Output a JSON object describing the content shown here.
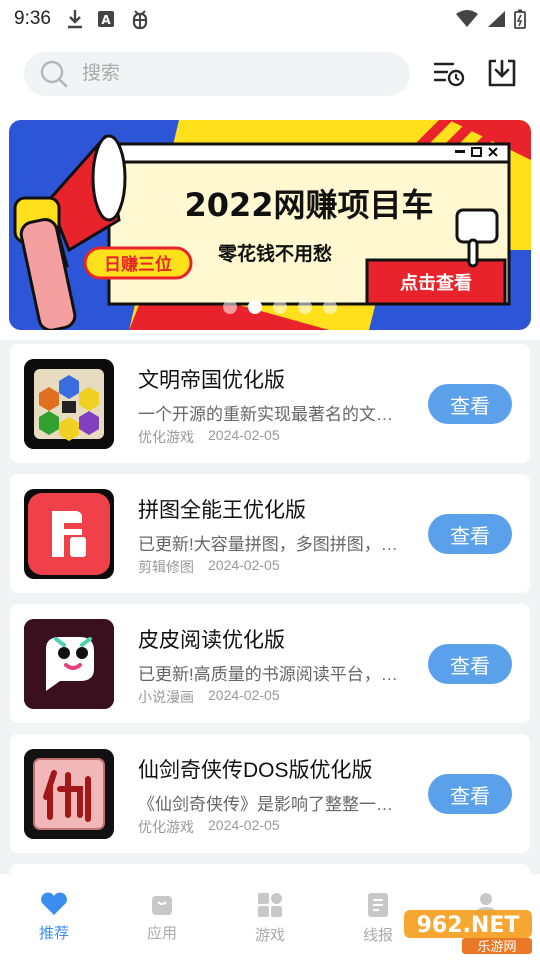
{
  "status_bar": {
    "time": "9:36"
  },
  "search": {
    "placeholder": "搜索"
  },
  "banner": {
    "headline": "2022网赚项目车",
    "tagline": "零花钱不用愁",
    "badge": "日赚三位",
    "cta": "点击查看",
    "slide_count": 5,
    "active_slide": 2
  },
  "apps": [
    {
      "title": "文明帝国优化版",
      "description": "一个开源的重新实现最著名的文明类游戏",
      "category": "优化游戏",
      "date": "2024-02-05",
      "button": "查看"
    },
    {
      "title": "拼图全能王优化版",
      "description": "已更新!大容量拼图，多图拼图，长图拼接",
      "category": "剪辑修图",
      "date": "2024-02-05",
      "button": "查看"
    },
    {
      "title": "皮皮阅读优化版",
      "description": "已更新!高质量的书源阅读平台，海量小说",
      "category": "小说漫画",
      "date": "2024-02-05",
      "button": "查看"
    },
    {
      "title": "仙剑奇侠传DOS版优化版",
      "description": "《仙剑奇侠传》是影响了整整一代人的经典",
      "category": "优化游戏",
      "date": "2024-02-05",
      "button": "查看"
    }
  ],
  "tabs": [
    {
      "label": "推荐",
      "icon": "heart-icon",
      "active": true
    },
    {
      "label": "应用",
      "icon": "bag-icon",
      "active": false
    },
    {
      "label": "游戏",
      "icon": "grid-icon",
      "active": false
    },
    {
      "label": "线报",
      "icon": "document-icon",
      "active": false
    },
    {
      "label": "",
      "icon": "person-icon",
      "active": false
    }
  ],
  "watermark": {
    "text": "962.NET",
    "subtext": "乐游网"
  },
  "colors": {
    "accent": "#3a8ef0",
    "button": "#5aa0ea",
    "banner_yellow": "#ffe01a",
    "banner_red": "#e8232b",
    "banner_blue": "#2d55d8"
  }
}
